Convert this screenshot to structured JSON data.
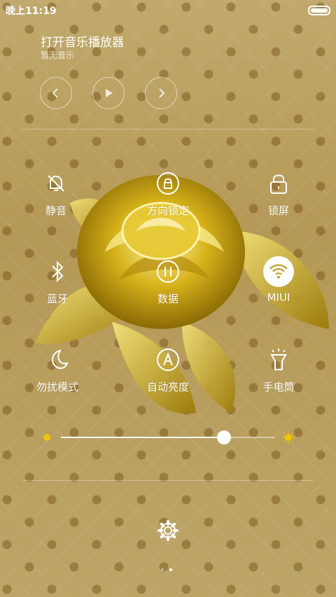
{
  "status": {
    "time": "晚上11:19"
  },
  "music": {
    "title": "打开音乐播放器",
    "subtitle": "暂无音乐"
  },
  "tiles": [
    {
      "label": "静音",
      "icon": "bell-muted-icon"
    },
    {
      "label": "方向锁定",
      "icon": "rotation-lock-icon"
    },
    {
      "label": "锁屏",
      "icon": "lock-icon"
    },
    {
      "label": "蓝牙",
      "icon": "bluetooth-icon"
    },
    {
      "label": "数据",
      "icon": "mobile-data-icon"
    },
    {
      "label": "MIUI",
      "icon": "wifi-icon",
      "active": true
    },
    {
      "label": "勿扰模式",
      "icon": "moon-icon"
    },
    {
      "label": "自动亮度",
      "icon": "auto-brightness-icon"
    },
    {
      "label": "手电筒",
      "icon": "flashlight-icon"
    }
  ],
  "brightness": {
    "level": 0.76
  },
  "pager": {
    "pages": 2,
    "current": 2
  }
}
